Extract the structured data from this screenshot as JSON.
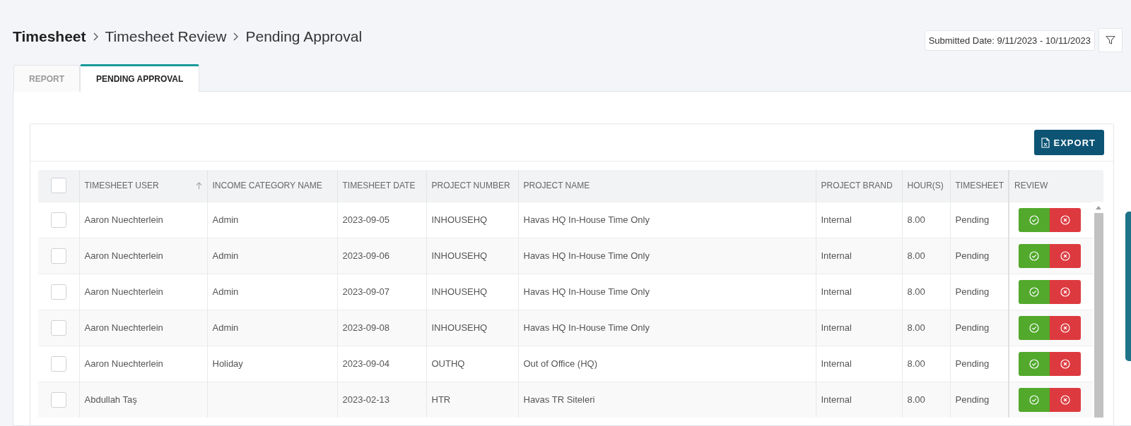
{
  "breadcrumb": [
    {
      "label": "Timesheet"
    },
    {
      "label": "Timesheet Review"
    },
    {
      "label": "Pending Approval"
    }
  ],
  "date_filter": {
    "label": "Submitted Date: 9/11/2023 - 10/11/2023"
  },
  "tabs": [
    {
      "label": "REPORT",
      "selected": false
    },
    {
      "label": "PENDING APPROVAL",
      "selected": true
    }
  ],
  "export_button": {
    "label": "EXPORT"
  },
  "table": {
    "select_all": {
      "checked": false
    },
    "columns": [
      {
        "label": "TIMESHEET USER",
        "sorted": true
      },
      {
        "label": "INCOME CATEGORY NAME",
        "sorted": false
      },
      {
        "label": "TIMESHEET DATE",
        "sorted": false
      },
      {
        "label": "PROJECT NUMBER",
        "sorted": false
      },
      {
        "label": "PROJECT NAME",
        "sorted": false
      },
      {
        "label": "PROJECT BRAND",
        "sorted": false
      },
      {
        "label": "HOUR(S)",
        "sorted": false
      },
      {
        "label": "TIMESHEET",
        "sorted": false
      },
      {
        "label": "REVIEW",
        "sorted": false
      }
    ],
    "rows": [
      {
        "checked": false,
        "cells": [
          "Aaron Nuechterlein",
          "Admin",
          "2023-09-05",
          "INHOUSEHQ",
          "Havas HQ In-House Time Only",
          "Internal",
          "8.00",
          "Pending"
        ]
      },
      {
        "checked": false,
        "cells": [
          "Aaron Nuechterlein",
          "Admin",
          "2023-09-06",
          "INHOUSEHQ",
          "Havas HQ In-House Time Only",
          "Internal",
          "8.00",
          "Pending"
        ]
      },
      {
        "checked": false,
        "cells": [
          "Aaron Nuechterlein",
          "Admin",
          "2023-09-07",
          "INHOUSEHQ",
          "Havas HQ In-House Time Only",
          "Internal",
          "8.00",
          "Pending"
        ]
      },
      {
        "checked": false,
        "cells": [
          "Aaron Nuechterlein",
          "Admin",
          "2023-09-08",
          "INHOUSEHQ",
          "Havas HQ In-House Time Only",
          "Internal",
          "8.00",
          "Pending"
        ]
      },
      {
        "checked": false,
        "cells": [
          "Aaron Nuechterlein",
          "Holiday",
          "2023-09-04",
          "OUTHQ",
          "Out of Office (HQ)",
          "Internal",
          "8.00",
          "Pending"
        ]
      },
      {
        "checked": false,
        "cells": [
          "Abdullah Taş",
          "",
          "2023-02-13",
          "HTR",
          "Havas TR Siteleri",
          "Internal",
          "8.00",
          "Pending"
        ]
      }
    ]
  }
}
